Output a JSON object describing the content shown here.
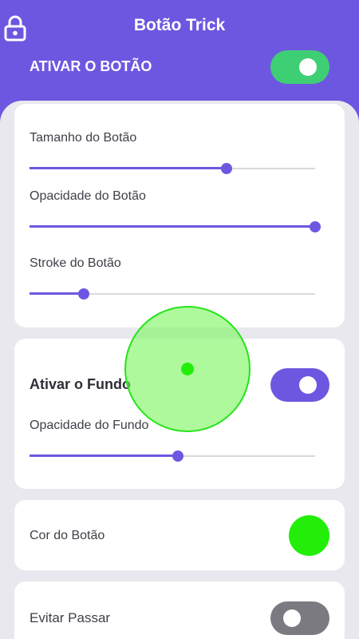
{
  "header": {
    "title": "Botão Trick",
    "lock_icon": "lock-icon",
    "activate_label": "ATIVAR O BOTÃO",
    "activate_on": true
  },
  "button_settings": {
    "size_label": "Tamanho do Botão",
    "size_value": 0.69,
    "opacity_label": "Opacidade do Botão",
    "opacity_value": 1.0,
    "stroke_label": "Stroke do Botão",
    "stroke_value": 0.19
  },
  "background_settings": {
    "activate_label": "Ativar o Fundo",
    "activate_on": true,
    "opacity_label": "Opacidade do Fundo",
    "opacity_value": 0.52
  },
  "color_settings": {
    "label": "Cor do Botão",
    "color": "#22ee0a"
  },
  "avoid_settings": {
    "label": "Evitar Passar",
    "enabled": false
  },
  "colors": {
    "accent": "#6e57e0",
    "toggle_on_header": "#3ecf74",
    "toggle_off": "#7a7a80",
    "floating_fill": "#7df55f",
    "floating_stroke": "#26e31a"
  }
}
